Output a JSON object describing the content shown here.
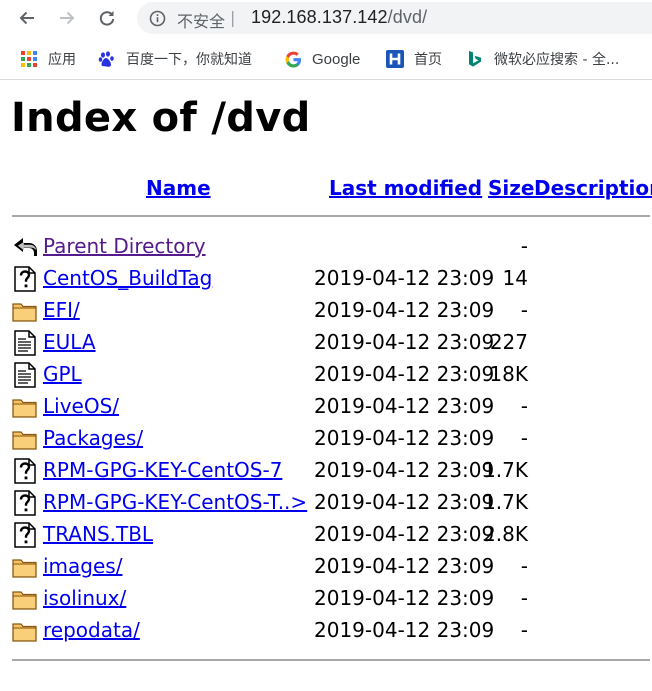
{
  "browser": {
    "security_label": "不安全",
    "separator": "|",
    "url_host": "192.168.137.142",
    "url_path": "/dvd/"
  },
  "bookmarks": [
    {
      "label": "应用",
      "icon": "apps-grid-icon"
    },
    {
      "label": "百度一下，你就知道",
      "icon": "baidu-paw-icon"
    },
    {
      "label": "Google",
      "icon": "google-g-icon"
    },
    {
      "label": "首页",
      "icon": "h-logo-icon"
    },
    {
      "label": "微软必应搜索 - 全...",
      "icon": "bing-icon"
    }
  ],
  "page": {
    "title": "Index of /dvd",
    "columns": {
      "name": "Name",
      "last_modified": "Last modified",
      "size": "Size",
      "description": "Description"
    }
  },
  "entries": [
    {
      "name": "Parent Directory",
      "date": "",
      "size": "-",
      "type": "back",
      "visited": true
    },
    {
      "name": "CentOS_BuildTag",
      "date": "2019-04-12 23:09",
      "size": "14",
      "type": "unknown"
    },
    {
      "name": "EFI/",
      "date": "2019-04-12 23:09",
      "size": "-",
      "type": "folder"
    },
    {
      "name": "EULA",
      "date": "2019-04-12 23:09",
      "size": "227",
      "type": "text"
    },
    {
      "name": "GPL",
      "date": "2019-04-12 23:09",
      "size": "18K",
      "type": "text"
    },
    {
      "name": "LiveOS/",
      "date": "2019-04-12 23:09",
      "size": "-",
      "type": "folder"
    },
    {
      "name": "Packages/",
      "date": "2019-04-12 23:09",
      "size": "-",
      "type": "folder"
    },
    {
      "name": "RPM-GPG-KEY-CentOS-7",
      "date": "2019-04-12 23:09",
      "size": "1.7K",
      "type": "unknown"
    },
    {
      "name": "RPM-GPG-KEY-CentOS-T..>",
      "date": "2019-04-12 23:09",
      "size": "1.7K",
      "type": "unknown"
    },
    {
      "name": "TRANS.TBL",
      "date": "2019-04-12 23:09",
      "size": "2.8K",
      "type": "unknown"
    },
    {
      "name": "images/",
      "date": "2019-04-12 23:09",
      "size": "-",
      "type": "folder"
    },
    {
      "name": "isolinux/",
      "date": "2019-04-12 23:09",
      "size": "-",
      "type": "folder"
    },
    {
      "name": "repodata/",
      "date": "2019-04-12 23:09",
      "size": "-",
      "type": "folder"
    }
  ]
}
